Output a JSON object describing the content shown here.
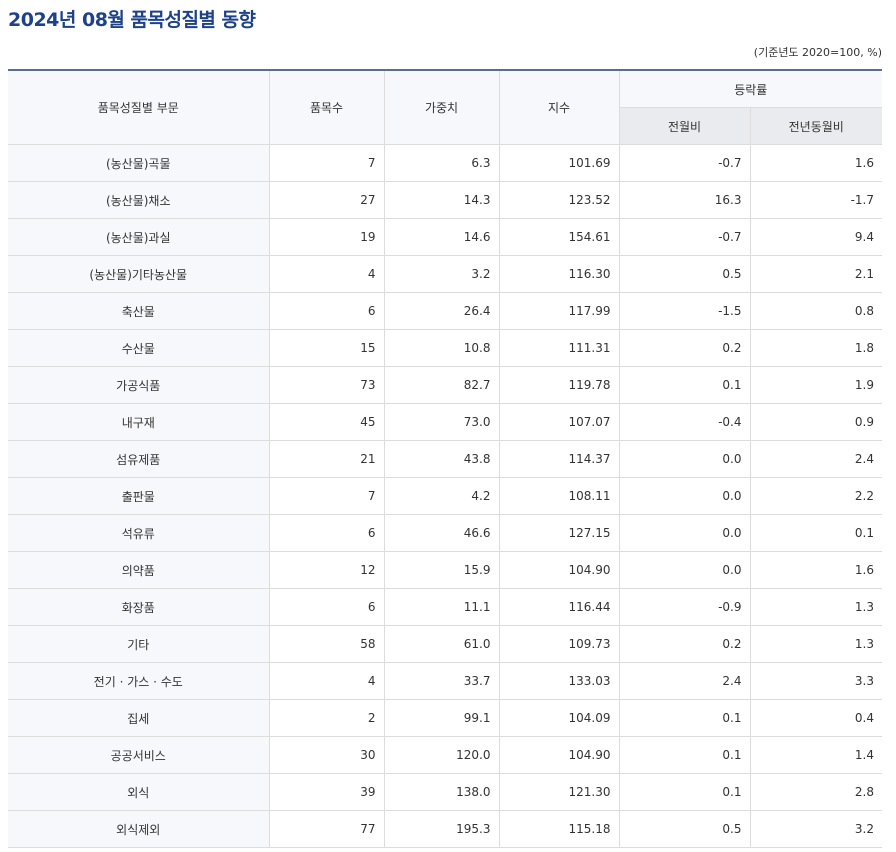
{
  "title": "2024년 08월 품목성질별 동향",
  "unit": "(기준년도 2020=100, %)",
  "headers": {
    "category": "품목성질별 부문",
    "item_count": "품목수",
    "weight": "가중치",
    "index": "지수",
    "change": "등락률",
    "mom": "전월비",
    "yoy": "전년동월비"
  },
  "rows": [
    {
      "category": "(농산물)곡물",
      "item_count": "7",
      "weight": "6.3",
      "index": "101.69",
      "mom": "-0.7",
      "yoy": "1.6"
    },
    {
      "category": "(농산물)채소",
      "item_count": "27",
      "weight": "14.3",
      "index": "123.52",
      "mom": "16.3",
      "yoy": "-1.7"
    },
    {
      "category": "(농산물)과실",
      "item_count": "19",
      "weight": "14.6",
      "index": "154.61",
      "mom": "-0.7",
      "yoy": "9.4"
    },
    {
      "category": "(농산물)기타농산물",
      "item_count": "4",
      "weight": "3.2",
      "index": "116.30",
      "mom": "0.5",
      "yoy": "2.1"
    },
    {
      "category": "축산물",
      "item_count": "6",
      "weight": "26.4",
      "index": "117.99",
      "mom": "-1.5",
      "yoy": "0.8"
    },
    {
      "category": "수산물",
      "item_count": "15",
      "weight": "10.8",
      "index": "111.31",
      "mom": "0.2",
      "yoy": "1.8"
    },
    {
      "category": "가공식품",
      "item_count": "73",
      "weight": "82.7",
      "index": "119.78",
      "mom": "0.1",
      "yoy": "1.9"
    },
    {
      "category": "내구재",
      "item_count": "45",
      "weight": "73.0",
      "index": "107.07",
      "mom": "-0.4",
      "yoy": "0.9"
    },
    {
      "category": "섬유제품",
      "item_count": "21",
      "weight": "43.8",
      "index": "114.37",
      "mom": "0.0",
      "yoy": "2.4"
    },
    {
      "category": "출판물",
      "item_count": "7",
      "weight": "4.2",
      "index": "108.11",
      "mom": "0.0",
      "yoy": "2.2"
    },
    {
      "category": "석유류",
      "item_count": "6",
      "weight": "46.6",
      "index": "127.15",
      "mom": "0.0",
      "yoy": "0.1"
    },
    {
      "category": "의약품",
      "item_count": "12",
      "weight": "15.9",
      "index": "104.90",
      "mom": "0.0",
      "yoy": "1.6"
    },
    {
      "category": "화장품",
      "item_count": "6",
      "weight": "11.1",
      "index": "116.44",
      "mom": "-0.9",
      "yoy": "1.3"
    },
    {
      "category": "기타",
      "item_count": "58",
      "weight": "61.0",
      "index": "109.73",
      "mom": "0.2",
      "yoy": "1.3"
    },
    {
      "category": "전기 · 가스 · 수도",
      "item_count": "4",
      "weight": "33.7",
      "index": "133.03",
      "mom": "2.4",
      "yoy": "3.3"
    },
    {
      "category": "집세",
      "item_count": "2",
      "weight": "99.1",
      "index": "104.09",
      "mom": "0.1",
      "yoy": "0.4"
    },
    {
      "category": "공공서비스",
      "item_count": "30",
      "weight": "120.0",
      "index": "104.90",
      "mom": "0.1",
      "yoy": "1.4"
    },
    {
      "category": "외식",
      "item_count": "39",
      "weight": "138.0",
      "index": "121.30",
      "mom": "0.1",
      "yoy": "2.8"
    },
    {
      "category": "외식제외",
      "item_count": "77",
      "weight": "195.3",
      "index": "115.18",
      "mom": "0.5",
      "yoy": "3.2"
    }
  ]
}
